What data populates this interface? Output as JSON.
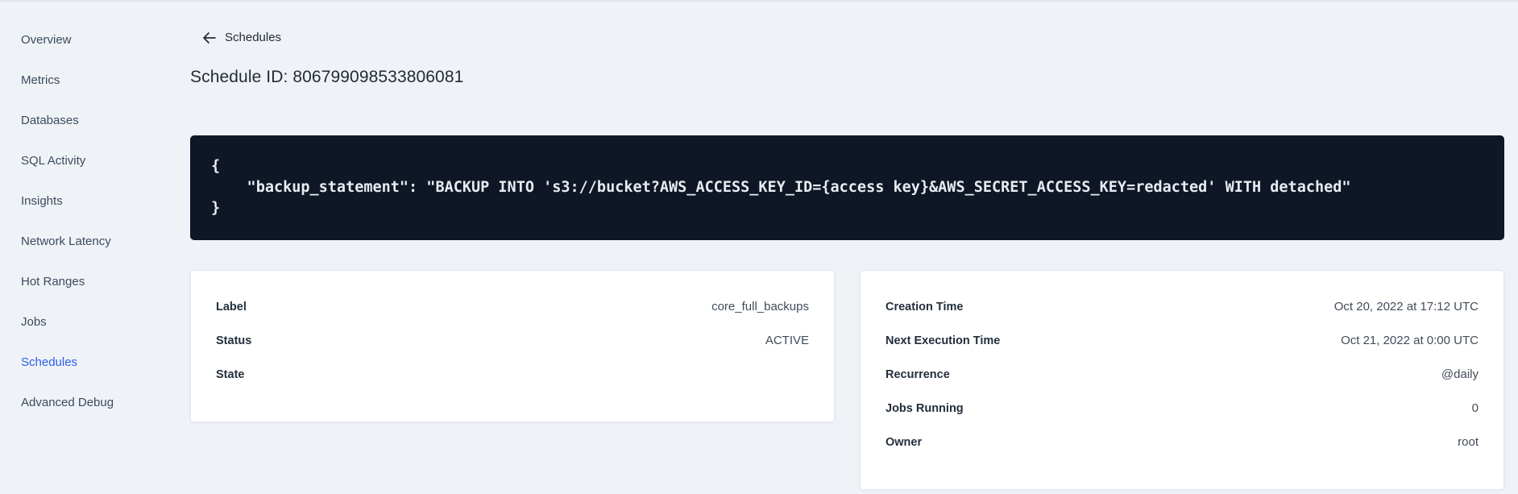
{
  "colors": {
    "page_bg": "#eff3f8",
    "accent_blue": "#2b5dea",
    "nav_text": "#3d4a5c",
    "code_bg": "#0f1726",
    "code_text": "#e8ecf1"
  },
  "sidebar": {
    "items": [
      {
        "label": "Overview",
        "active": false
      },
      {
        "label": "Metrics",
        "active": false
      },
      {
        "label": "Databases",
        "active": false
      },
      {
        "label": "SQL Activity",
        "active": false
      },
      {
        "label": "Insights",
        "active": false
      },
      {
        "label": "Network Latency",
        "active": false
      },
      {
        "label": "Hot Ranges",
        "active": false
      },
      {
        "label": "Jobs",
        "active": false
      },
      {
        "label": "Schedules",
        "active": true
      },
      {
        "label": "Advanced Debug",
        "active": false
      }
    ]
  },
  "header": {
    "back_icon": "arrow-left",
    "back_label": "Schedules",
    "title": "Schedule ID: 806799098533806081"
  },
  "code_block": {
    "lines": [
      "{",
      "    \"backup_statement\": \"BACKUP INTO 's3://bucket?AWS_ACCESS_KEY_ID={access key}&AWS_SECRET_ACCESS_KEY=redacted' WITH detached\"",
      "}"
    ]
  },
  "cards": {
    "left": {
      "rows": [
        {
          "label": "Label",
          "value": "core_full_backups"
        },
        {
          "label": "Status",
          "value": "ACTIVE"
        },
        {
          "label": "State",
          "value": ""
        }
      ]
    },
    "right": {
      "rows": [
        {
          "label": "Creation Time",
          "value": "Oct 20, 2022 at 17:12 UTC"
        },
        {
          "label": "Next Execution Time",
          "value": "Oct 21, 2022 at 0:00 UTC"
        },
        {
          "label": "Recurrence",
          "value": "@daily"
        },
        {
          "label": "Jobs Running",
          "value": "0"
        },
        {
          "label": "Owner",
          "value": "root"
        }
      ]
    }
  }
}
